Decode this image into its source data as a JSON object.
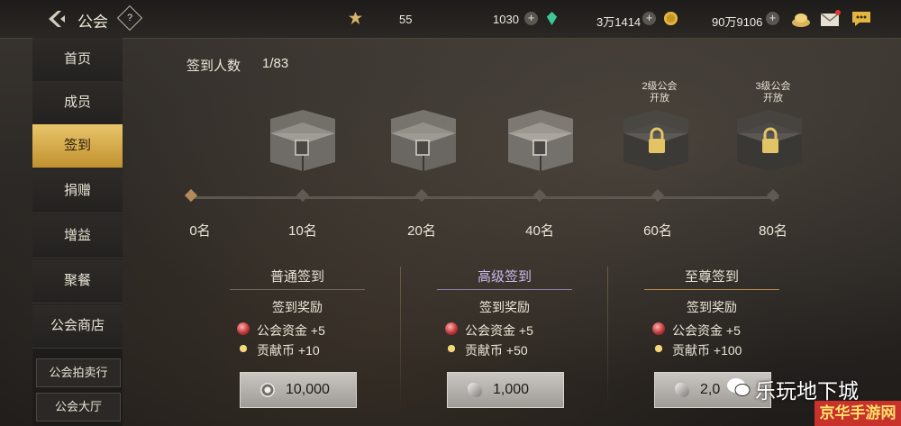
{
  "header": {
    "title": "公会",
    "help_icon": "?",
    "resources": [
      {
        "icon": "gear-coin-icon",
        "value": "55"
      },
      {
        "icon": "moon-crystal-icon",
        "value": "1030"
      },
      {
        "icon": "green-gem-icon",
        "value": "3万1414"
      },
      {
        "icon": "gold-coin-icon",
        "value": "90万9106"
      }
    ],
    "icons": [
      "treasure-icon",
      "mail-icon",
      "chat-icon"
    ]
  },
  "sidebar": {
    "items": [
      {
        "label": "首页"
      },
      {
        "label": "成员"
      },
      {
        "label": "签到",
        "active": true
      },
      {
        "label": "捐赠"
      },
      {
        "label": "增益"
      },
      {
        "label": "聚餐"
      },
      {
        "label": "公会商店"
      }
    ],
    "small_items": [
      {
        "label": "公会拍卖行"
      },
      {
        "label": "公会大厅"
      }
    ]
  },
  "signin": {
    "count_label": "签到人数",
    "count_value": "1/83",
    "chests": [
      {
        "rank": "10名",
        "locked": false
      },
      {
        "rank": "20名",
        "locked": false
      },
      {
        "rank": "40名",
        "locked": false
      },
      {
        "rank": "60名",
        "locked": true,
        "lock_text": "2级公会开放"
      },
      {
        "rank": "80名",
        "locked": true,
        "lock_text": "3级公会开放"
      }
    ],
    "start_rank": "0名",
    "lock_lines": [
      [
        "2级公会",
        "开放"
      ],
      [
        "3级公会",
        "开放"
      ]
    ]
  },
  "tiers": [
    {
      "title": "普通签到",
      "reward_title": "签到奖励",
      "fund": "公会资金 +5",
      "contrib": "贡献币 +10",
      "cost": "10,000",
      "cost_icon": "silver-coin-icon"
    },
    {
      "title": "高级签到",
      "reward_title": "签到奖励",
      "fund": "公会资金 +5",
      "contrib": "贡献币 +50",
      "cost": "1,000",
      "cost_icon": "crystal-icon"
    },
    {
      "title": "至尊签到",
      "reward_title": "签到奖励",
      "fund": "公会资金 +5",
      "contrib": "贡献币 +100",
      "cost": "2,0",
      "cost_icon": "crystal-icon"
    }
  ],
  "watermark": {
    "text": "乐玩地下城",
    "badge": "京华手游网"
  },
  "colors": {
    "accent_gold": "#d7ad4e",
    "badge_red": "#c9322b"
  }
}
